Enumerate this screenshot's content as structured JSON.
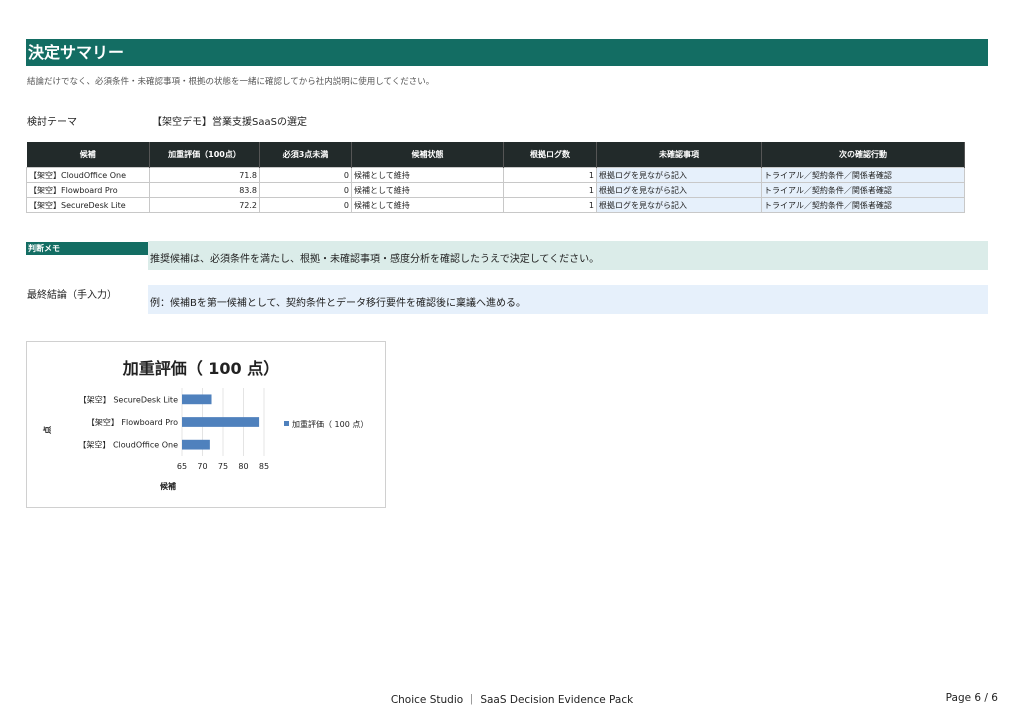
{
  "page": {
    "title": "決定サマリー",
    "subtitle": "結論だけでなく、必須条件・未確認事項・根拠の状態を一緒に確認してから社内説明に使用してください。",
    "theme_label": "検討テーマ",
    "theme_value": "【架空デモ】営業支援SaaSの選定"
  },
  "table": {
    "headers": [
      "候補",
      "加重評価（100点）",
      "必須3点未満",
      "候補状態",
      "根拠ログ数",
      "未確認事項",
      "次の確認行動"
    ],
    "rows": [
      [
        "【架空】CloudOffice One",
        "71.8",
        "0",
        "候補として維持",
        "1",
        "根拠ログを見ながら記入",
        "トライアル／契約条件／関係者確認"
      ],
      [
        "【架空】Flowboard Pro",
        "83.8",
        "0",
        "候補として維持",
        "1",
        "根拠ログを見ながら記入",
        "トライアル／契約条件／関係者確認"
      ],
      [
        "【架空】SecureDesk Lite",
        "72.2",
        "0",
        "候補として維持",
        "1",
        "根拠ログを見ながら記入",
        "トライアル／契約条件／関係者確認"
      ]
    ]
  },
  "memo": {
    "label": "判断メモ",
    "text": "推奨候補は、必須条件を満たし、根拠・未確認事項・感度分析を確認したうえで決定してください。"
  },
  "final": {
    "label": "最終結論（手入力）",
    "text": "例：候補Bを第一候補として、契約条件とデータ移行要件を確認後に稟議へ進める。"
  },
  "chart_data": {
    "type": "bar",
    "orientation": "horizontal",
    "title": "加重評価（ 100 点）",
    "xlabel": "候補",
    "ylabel": "点",
    "categories": [
      "【架空】 CloudOffice One",
      "【架空】 Flowboard Pro",
      "【架空】 SecureDesk Lite"
    ],
    "series": [
      {
        "name": "加重評価（ 100 点）",
        "values": [
          71.8,
          83.8,
          72.2
        ]
      }
    ],
    "xlim": [
      65,
      85
    ],
    "ticks": [
      65,
      70,
      75,
      80,
      85
    ],
    "grid": true,
    "legend": "right",
    "bar_color": "#4f81bd"
  },
  "footer": {
    "center": "Choice Studio ｜ SaaS Decision Evidence Pack",
    "right": "Page 6 / 6"
  }
}
